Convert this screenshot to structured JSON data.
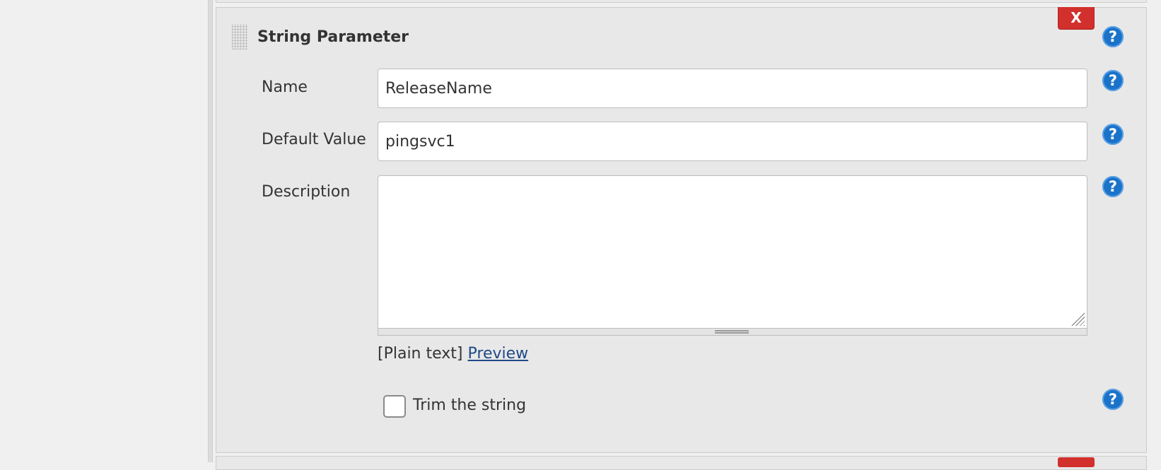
{
  "parameter": {
    "title": "String Parameter",
    "delete_label": "X",
    "help_glyph": "?"
  },
  "fields": {
    "name": {
      "label": "Name",
      "value": "ReleaseName"
    },
    "default_value": {
      "label": "Default Value",
      "value": "pingsvc1"
    },
    "description": {
      "label": "Description",
      "value": ""
    }
  },
  "format": {
    "plain_text": "[Plain text]",
    "preview_link": "Preview"
  },
  "trim": {
    "label": "Trim the string",
    "checked": false
  },
  "colors": {
    "delete_button": "#d2302c",
    "help_icon": "#1a73c8",
    "link": "#204a87",
    "panel_background": "#e8e8e8"
  },
  "icons": {
    "drag": "drag-handle-icon",
    "help": "help-icon",
    "resize": "resize-grip-icon"
  }
}
